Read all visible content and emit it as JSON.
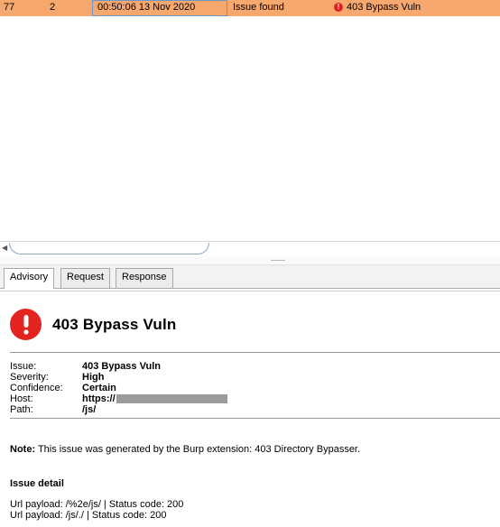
{
  "issues_table": {
    "selected_row": {
      "number": "77",
      "tool": "2",
      "time": "00:50:06 13 Nov 2020",
      "type": "Issue found",
      "issue": "403 Bypass Vuln"
    }
  },
  "tabs": [
    {
      "label": "Advisory",
      "active": true
    },
    {
      "label": "Request",
      "active": false
    },
    {
      "label": "Response",
      "active": false
    }
  ],
  "advisory": {
    "title": "403 Bypass Vuln",
    "fields": {
      "issue_label": "Issue:",
      "issue_value": "403 Bypass Vuln",
      "severity_label": "Severity:",
      "severity_value": "High",
      "confidence_label": "Confidence:",
      "confidence_value": "Certain",
      "host_label": "Host:",
      "host_value": "https://",
      "path_label": "Path:",
      "path_value": "/js/"
    },
    "note_label": "Note:",
    "note_text": " This issue was generated by the Burp extension: 403 Directory Bypasser.",
    "detail_heading": "Issue detail",
    "detail_lines": [
      "Url payload: /%2e/js/ | Status code: 200",
      "Url payload: /js/./ | Status code: 200"
    ]
  },
  "colors": {
    "selected_row": "#f6a86e",
    "alert_red": "#e3231f",
    "redaction": "#9b9b9b"
  },
  "icons": {
    "issue_severity": "alert-circle-icon",
    "advisory_header": "alert-circle-icon"
  }
}
